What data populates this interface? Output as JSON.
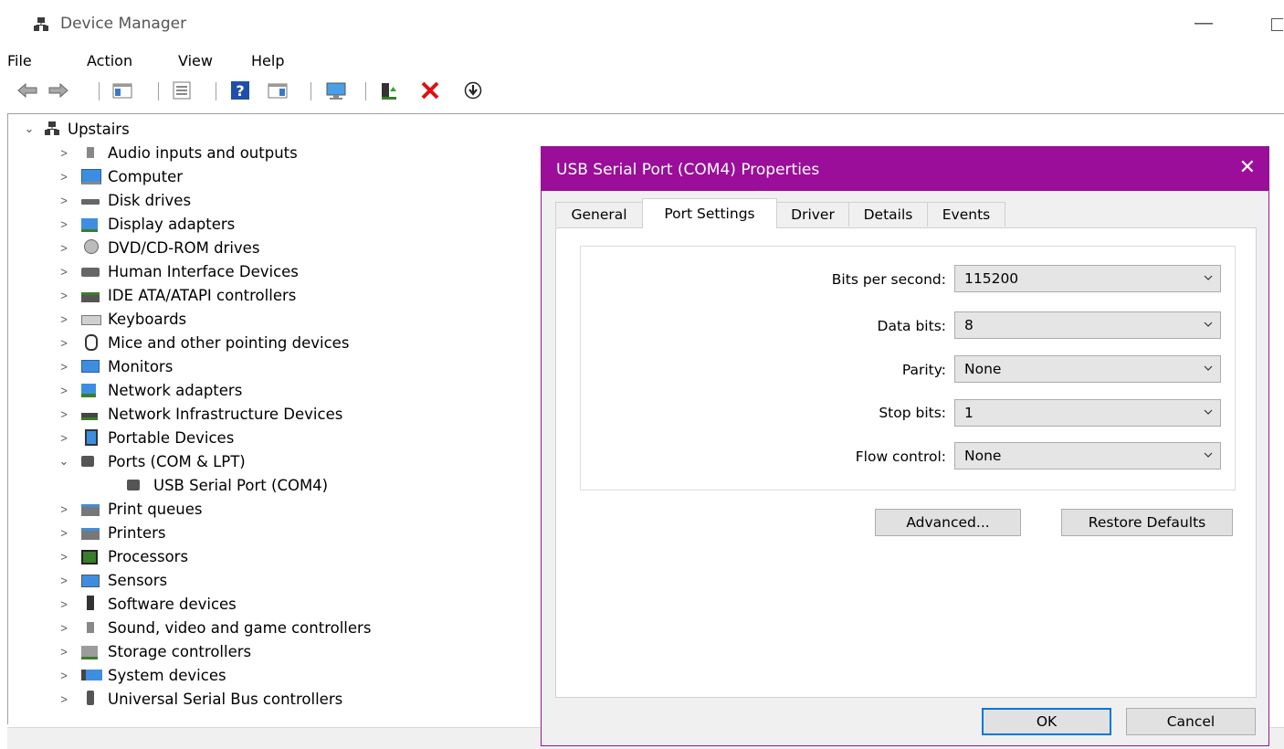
{
  "window": {
    "title": "Device Manager",
    "minimize_glyph": "—"
  },
  "menu": [
    "File",
    "Action",
    "View",
    "Help"
  ],
  "toolbar": {
    "icons": [
      "back-icon",
      "forward-icon",
      "show-hide-console-tree-icon",
      "properties-icon",
      "help-icon",
      "action-pane-icon",
      "scan-hardware-icon",
      "update-driver-icon",
      "uninstall-device-icon",
      "disable-device-icon"
    ]
  },
  "tree": {
    "root": {
      "label": "Upstairs",
      "expanded": true
    },
    "items": [
      {
        "label": "Audio inputs and outputs",
        "expanded": false,
        "icon": "speaker-icon"
      },
      {
        "label": "Computer",
        "expanded": false,
        "icon": "computer-icon"
      },
      {
        "label": "Disk drives",
        "expanded": false,
        "icon": "disk-drive-icon"
      },
      {
        "label": "Display adapters",
        "expanded": false,
        "icon": "display-adapter-icon"
      },
      {
        "label": "DVD/CD-ROM drives",
        "expanded": false,
        "icon": "dvd-icon"
      },
      {
        "label": "Human Interface Devices",
        "expanded": false,
        "icon": "hid-icon"
      },
      {
        "label": "IDE ATA/ATAPI controllers",
        "expanded": false,
        "icon": "ide-icon"
      },
      {
        "label": "Keyboards",
        "expanded": false,
        "icon": "keyboard-icon"
      },
      {
        "label": "Mice and other pointing devices",
        "expanded": false,
        "icon": "mouse-icon"
      },
      {
        "label": "Monitors",
        "expanded": false,
        "icon": "monitor-icon"
      },
      {
        "label": "Network adapters",
        "expanded": false,
        "icon": "network-adapter-icon"
      },
      {
        "label": "Network Infrastructure Devices",
        "expanded": false,
        "icon": "network-infrastructure-icon"
      },
      {
        "label": "Portable Devices",
        "expanded": false,
        "icon": "portable-device-icon"
      },
      {
        "label": "Ports (COM & LPT)",
        "expanded": true,
        "icon": "port-icon"
      },
      {
        "label": "USB Serial Port (COM4)",
        "child": true,
        "icon": "port-icon"
      },
      {
        "label": "Print queues",
        "expanded": false,
        "icon": "print-queue-icon"
      },
      {
        "label": "Printers",
        "expanded": false,
        "icon": "printer-icon"
      },
      {
        "label": "Processors",
        "expanded": false,
        "icon": "processor-icon"
      },
      {
        "label": "Sensors",
        "expanded": false,
        "icon": "sensor-icon"
      },
      {
        "label": "Software devices",
        "expanded": false,
        "icon": "software-device-icon"
      },
      {
        "label": "Sound, video and game controllers",
        "expanded": false,
        "icon": "sound-icon"
      },
      {
        "label": "Storage controllers",
        "expanded": false,
        "icon": "storage-controller-icon"
      },
      {
        "label": "System devices",
        "expanded": false,
        "icon": "system-device-icon"
      },
      {
        "label": "Universal Serial Bus controllers",
        "expanded": false,
        "icon": "usb-icon"
      }
    ]
  },
  "dialog": {
    "title": "USB Serial Port (COM4) Properties",
    "close_glyph": "✕",
    "accent_color": "#9a0e9a",
    "tabs": [
      "General",
      "Port Settings",
      "Driver",
      "Details",
      "Events"
    ],
    "active_tab": "Port Settings",
    "fields": [
      {
        "label": "Bits per second:",
        "value": "115200"
      },
      {
        "label": "Data bits:",
        "value": "8"
      },
      {
        "label": "Parity:",
        "value": "None"
      },
      {
        "label": "Stop bits:",
        "value": "1"
      },
      {
        "label": "Flow control:",
        "value": "None"
      }
    ],
    "advanced_label": "Advanced...",
    "restore_label": "Restore Defaults",
    "ok_label": "OK",
    "cancel_label": "Cancel"
  }
}
